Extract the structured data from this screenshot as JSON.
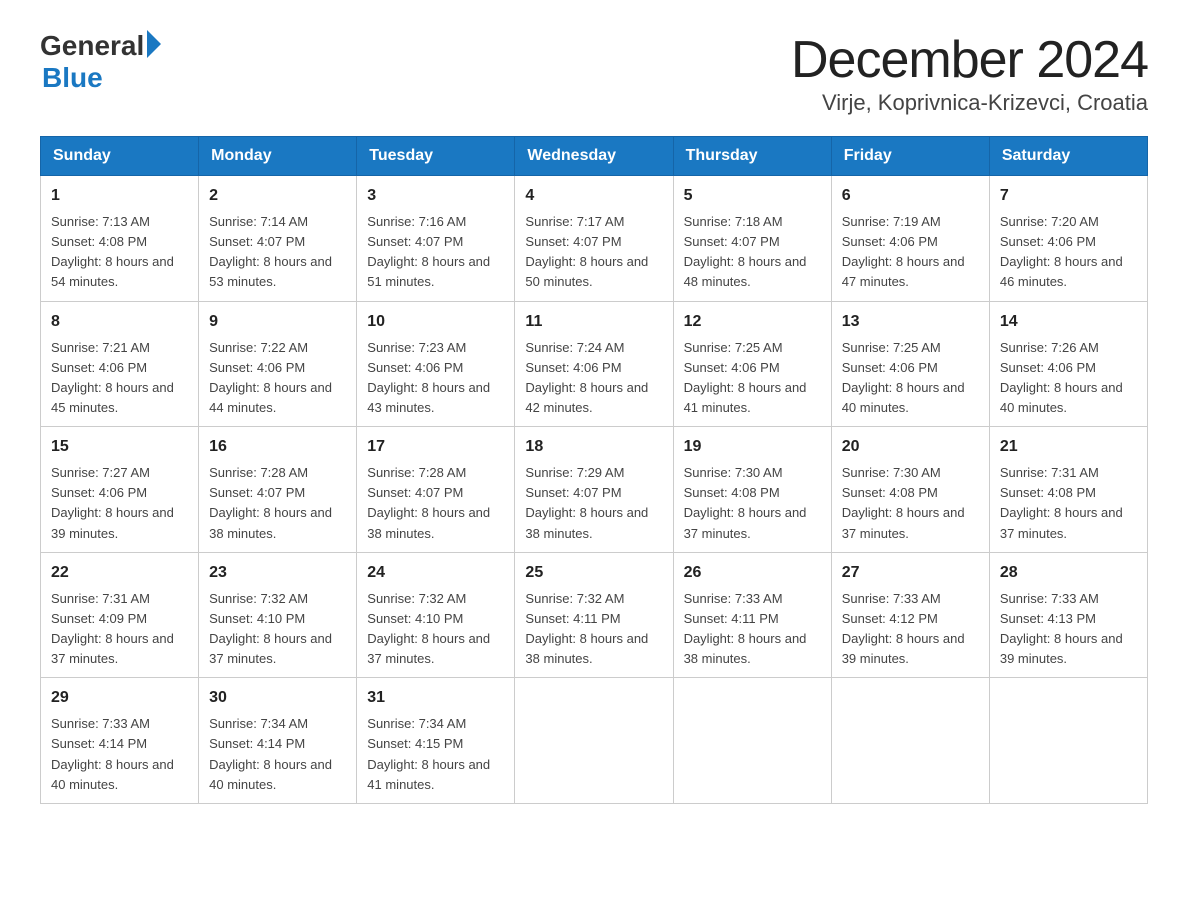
{
  "logo": {
    "text_general": "General",
    "text_blue": "Blue",
    "triangle": "▶"
  },
  "header": {
    "month_year": "December 2024",
    "location": "Virje, Koprivnica-Krizevci, Croatia"
  },
  "weekdays": [
    "Sunday",
    "Monday",
    "Tuesday",
    "Wednesday",
    "Thursday",
    "Friday",
    "Saturday"
  ],
  "weeks": [
    [
      {
        "day": "1",
        "sunrise": "7:13 AM",
        "sunset": "4:08 PM",
        "daylight": "8 hours and 54 minutes."
      },
      {
        "day": "2",
        "sunrise": "7:14 AM",
        "sunset": "4:07 PM",
        "daylight": "8 hours and 53 minutes."
      },
      {
        "day": "3",
        "sunrise": "7:16 AM",
        "sunset": "4:07 PM",
        "daylight": "8 hours and 51 minutes."
      },
      {
        "day": "4",
        "sunrise": "7:17 AM",
        "sunset": "4:07 PM",
        "daylight": "8 hours and 50 minutes."
      },
      {
        "day": "5",
        "sunrise": "7:18 AM",
        "sunset": "4:07 PM",
        "daylight": "8 hours and 48 minutes."
      },
      {
        "day": "6",
        "sunrise": "7:19 AM",
        "sunset": "4:06 PM",
        "daylight": "8 hours and 47 minutes."
      },
      {
        "day": "7",
        "sunrise": "7:20 AM",
        "sunset": "4:06 PM",
        "daylight": "8 hours and 46 minutes."
      }
    ],
    [
      {
        "day": "8",
        "sunrise": "7:21 AM",
        "sunset": "4:06 PM",
        "daylight": "8 hours and 45 minutes."
      },
      {
        "day": "9",
        "sunrise": "7:22 AM",
        "sunset": "4:06 PM",
        "daylight": "8 hours and 44 minutes."
      },
      {
        "day": "10",
        "sunrise": "7:23 AM",
        "sunset": "4:06 PM",
        "daylight": "8 hours and 43 minutes."
      },
      {
        "day": "11",
        "sunrise": "7:24 AM",
        "sunset": "4:06 PM",
        "daylight": "8 hours and 42 minutes."
      },
      {
        "day": "12",
        "sunrise": "7:25 AM",
        "sunset": "4:06 PM",
        "daylight": "8 hours and 41 minutes."
      },
      {
        "day": "13",
        "sunrise": "7:25 AM",
        "sunset": "4:06 PM",
        "daylight": "8 hours and 40 minutes."
      },
      {
        "day": "14",
        "sunrise": "7:26 AM",
        "sunset": "4:06 PM",
        "daylight": "8 hours and 40 minutes."
      }
    ],
    [
      {
        "day": "15",
        "sunrise": "7:27 AM",
        "sunset": "4:06 PM",
        "daylight": "8 hours and 39 minutes."
      },
      {
        "day": "16",
        "sunrise": "7:28 AM",
        "sunset": "4:07 PM",
        "daylight": "8 hours and 38 minutes."
      },
      {
        "day": "17",
        "sunrise": "7:28 AM",
        "sunset": "4:07 PM",
        "daylight": "8 hours and 38 minutes."
      },
      {
        "day": "18",
        "sunrise": "7:29 AM",
        "sunset": "4:07 PM",
        "daylight": "8 hours and 38 minutes."
      },
      {
        "day": "19",
        "sunrise": "7:30 AM",
        "sunset": "4:08 PM",
        "daylight": "8 hours and 37 minutes."
      },
      {
        "day": "20",
        "sunrise": "7:30 AM",
        "sunset": "4:08 PM",
        "daylight": "8 hours and 37 minutes."
      },
      {
        "day": "21",
        "sunrise": "7:31 AM",
        "sunset": "4:08 PM",
        "daylight": "8 hours and 37 minutes."
      }
    ],
    [
      {
        "day": "22",
        "sunrise": "7:31 AM",
        "sunset": "4:09 PM",
        "daylight": "8 hours and 37 minutes."
      },
      {
        "day": "23",
        "sunrise": "7:32 AM",
        "sunset": "4:10 PM",
        "daylight": "8 hours and 37 minutes."
      },
      {
        "day": "24",
        "sunrise": "7:32 AM",
        "sunset": "4:10 PM",
        "daylight": "8 hours and 37 minutes."
      },
      {
        "day": "25",
        "sunrise": "7:32 AM",
        "sunset": "4:11 PM",
        "daylight": "8 hours and 38 minutes."
      },
      {
        "day": "26",
        "sunrise": "7:33 AM",
        "sunset": "4:11 PM",
        "daylight": "8 hours and 38 minutes."
      },
      {
        "day": "27",
        "sunrise": "7:33 AM",
        "sunset": "4:12 PM",
        "daylight": "8 hours and 39 minutes."
      },
      {
        "day": "28",
        "sunrise": "7:33 AM",
        "sunset": "4:13 PM",
        "daylight": "8 hours and 39 minutes."
      }
    ],
    [
      {
        "day": "29",
        "sunrise": "7:33 AM",
        "sunset": "4:14 PM",
        "daylight": "8 hours and 40 minutes."
      },
      {
        "day": "30",
        "sunrise": "7:34 AM",
        "sunset": "4:14 PM",
        "daylight": "8 hours and 40 minutes."
      },
      {
        "day": "31",
        "sunrise": "7:34 AM",
        "sunset": "4:15 PM",
        "daylight": "8 hours and 41 minutes."
      },
      null,
      null,
      null,
      null
    ]
  ],
  "labels": {
    "sunrise": "Sunrise: ",
    "sunset": "Sunset: ",
    "daylight": "Daylight: "
  }
}
